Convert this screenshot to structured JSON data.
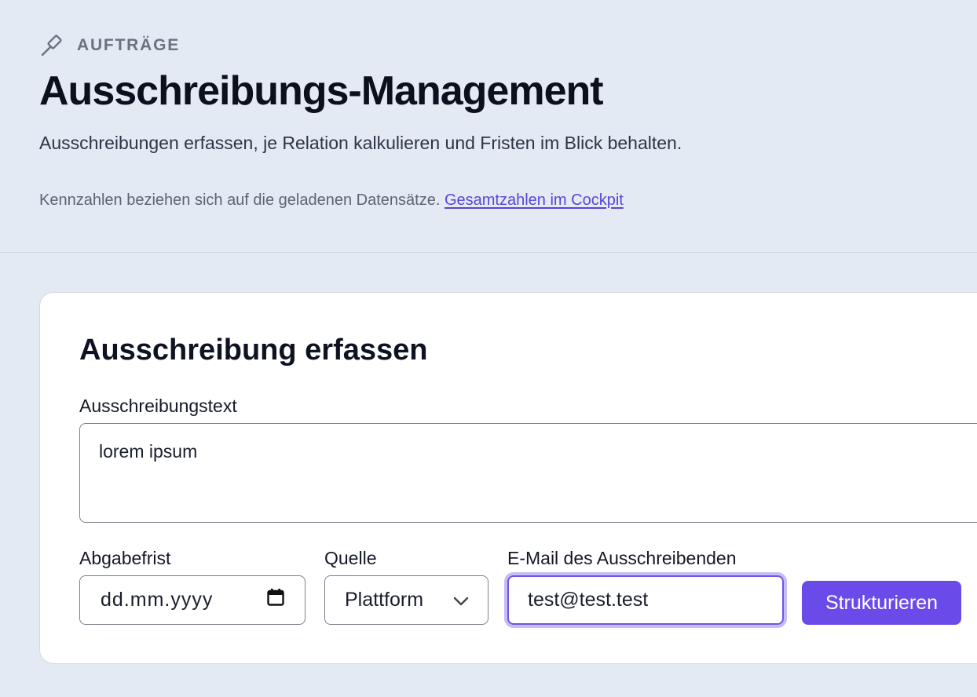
{
  "header": {
    "eyebrow_icon": "gavel-icon",
    "eyebrow": "AUFTRÄGE",
    "title": "Ausschreibungs-Management",
    "subtitle": "Ausschreibungen erfassen, je Relation kalkulieren und Fristen im Blick behalten.",
    "note": "Kennzahlen beziehen sich auf die geladenen Datensätze.",
    "note_link": "Gesamtzahlen im Cockpit"
  },
  "form": {
    "title": "Ausschreibung erfassen",
    "text_label": "Ausschreibungstext",
    "text_value": "lorem ipsum",
    "deadline_label": "Abgabefrist",
    "deadline_placeholder": "dd.mm.yyyy",
    "deadline_icon": "calendar-icon",
    "source_label": "Quelle",
    "source_value": "Plattform",
    "source_icon": "chevron-down-icon",
    "email_label": "E-Mail des Ausschreibenden",
    "email_value": "test@test.test",
    "submit_label": "Strukturieren"
  },
  "colors": {
    "background": "#e4eaf3",
    "accent": "#6a4be9",
    "link": "#5b44d6",
    "focus_ring": "#c6bcf6"
  }
}
